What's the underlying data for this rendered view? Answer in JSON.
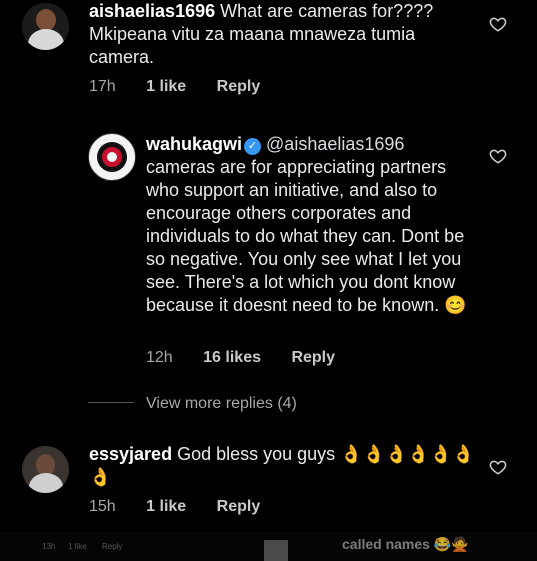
{
  "comments": [
    {
      "username": "aishaelias1696",
      "text": "What are cameras for???? Mkipeana vitu za maana mnaweza tumia camera.",
      "time": "17h",
      "likes": "1 like",
      "reply": "Reply"
    },
    {
      "username": "wahukagwi",
      "mention": "@aishaelias1696",
      "text": "cameras are for appreciating partners who support an initiative, and also to encourage others corporates and individuals to do what they can. Dont be so negative. You only see what I let you see. There's a lot which you dont know because it doesnt need to be known. 😊",
      "time": "12h",
      "likes": "16 likes",
      "reply": "Reply"
    },
    {
      "username": "essyjared",
      "text": "God bless you guys 👌👌👌👌👌👌👌",
      "time": "15h",
      "likes": "1 like",
      "reply": "Reply"
    }
  ],
  "view_more": "View more replies (4)",
  "footer": {
    "time": "13h",
    "likes": "1 like",
    "reply": "Reply",
    "partial_text": "called names 😂🙅"
  },
  "colors": {
    "verified": "#3897f0",
    "meta": "#a8a8a8"
  }
}
